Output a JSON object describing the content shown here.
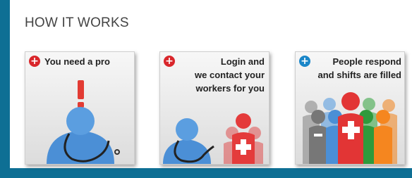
{
  "section": {
    "title": "HOW IT WORKS"
  },
  "colors": {
    "background": "#0e6f94",
    "badge_red": "#d9262b",
    "badge_blue": "#1a86c8",
    "figure_blue": "#4a90d9",
    "figure_red": "#e03a3a"
  },
  "steps": [
    {
      "icon": "plus-icon",
      "lines": [
        "You need a pro"
      ]
    },
    {
      "icon": "plus-icon",
      "lines": [
        "Login and",
        "we contact your",
        "workers for you"
      ]
    },
    {
      "icon": "plus-icon",
      "lines": [
        "People respond",
        "and shifts are filled"
      ]
    }
  ]
}
